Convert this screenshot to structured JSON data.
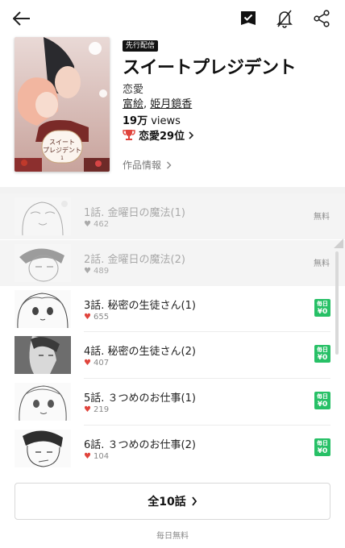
{
  "header": {
    "back_icon": "arrow-left-icon",
    "bookmark_icon": "bookmark-check-icon",
    "bell_icon": "bell-off-icon",
    "share_icon": "share-icon"
  },
  "series": {
    "badge": "先行配信",
    "title": "スイートプレジデント",
    "genre": "恋愛",
    "author1": "富絵",
    "author_sep": ", ",
    "author2": "姫月鏡香",
    "views_num": "19万",
    "views_unit": " views",
    "rank": "恋愛29位",
    "info_link": "作品情報",
    "cover_title_line1": "スイート",
    "cover_title_line2": "プレジデント",
    "cover_volume": "1"
  },
  "episodes": [
    {
      "title": "1話. 金曜日の魔法(1)",
      "likes": "462",
      "price": "無料",
      "read": true
    },
    {
      "title": "2話. 金曜日の魔法(2)",
      "likes": "489",
      "price": "無料",
      "read": true
    },
    {
      "title": "3話. 秘密の生徒さん(1)",
      "likes": "655",
      "daily_top": "毎日",
      "daily_bottom": "¥0",
      "read": false
    },
    {
      "title": "4話. 秘密の生徒さん(2)",
      "likes": "407",
      "daily_top": "毎日",
      "daily_bottom": "¥0",
      "read": false
    },
    {
      "title": "5話. ３つめのお仕事(1)",
      "likes": "219",
      "daily_top": "毎日",
      "daily_bottom": "¥0",
      "read": false
    },
    {
      "title": "6話. ３つめのお仕事(2)",
      "likes": "104",
      "daily_top": "毎日",
      "daily_bottom": "¥0",
      "read": false
    }
  ],
  "all_button": "全10話",
  "footer_note": "毎日無料",
  "colors": {
    "daily_badge": "#27c066",
    "heart": "#e0443c",
    "rank_trophy": "#e0443c"
  }
}
